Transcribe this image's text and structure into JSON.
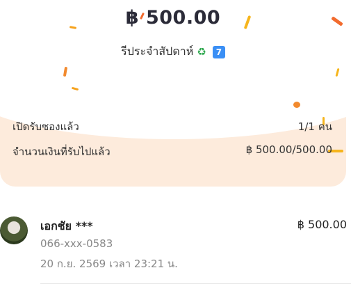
{
  "summary": {
    "amount": "฿ 500.00",
    "title": "รีประจำสัปดาห์",
    "title_badge": "7",
    "recycle_icon": "♻"
  },
  "info": {
    "opened_label": "เปิดรับซองแล้ว",
    "opened_value": "1/1 คน",
    "received_label": "จำนวนเงินที่รับไปแล้ว",
    "received_value": "฿ 500.00/500.00"
  },
  "recipients": [
    {
      "name": "เอกชัย ***",
      "phone": "066-xxx-0583",
      "datetime": "20 ก.ย. 2569 เวลา 23:21 น.",
      "amount": "฿ 500.00"
    }
  ],
  "colors": {
    "card_bg": "#fdebdc",
    "confetti_orange": "#f6a21c",
    "confetti_red": "#f26b2e"
  }
}
